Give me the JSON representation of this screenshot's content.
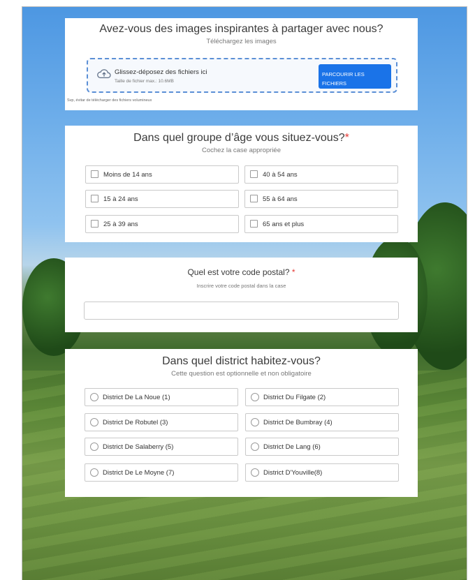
{
  "upload": {
    "title": "Avez-vous des images inspirantes à partager avec nous?",
    "subtitle": "Téléchargez les images",
    "drop_label": "Glissez-déposez des fichiers ici",
    "max_size": "Taille de fichier max.: 10.6MB",
    "browse_label_line1": "PARCOURIR LES",
    "browse_label_line2": "FICHIERS",
    "tip": "Svp, évitar de télécharger des fichiers volumineux"
  },
  "age": {
    "title": "Dans quel groupe d’âge vous situez-vous?",
    "required_mark": "*",
    "subtitle": "Cochez la case appropriée",
    "options": [
      "Moins de 14 ans",
      "40 à 54 ans",
      "15 à 24 ans",
      "55 à 64 ans",
      "25 à 39 ans",
      "65 ans et plus"
    ]
  },
  "postal": {
    "title": "Quel est votre code postal?",
    "required_mark": "*",
    "subtitle": "Inscrire votre code postal dans la case",
    "value": ""
  },
  "district": {
    "title": "Dans quel district habitez-vous?",
    "subtitle": "Cette question est optionnelle et non obligatoire",
    "options": [
      "District De La Noue (1)",
      "District Du Filgate (2)",
      "District De Robutel (3)",
      "District De Bumbray (4)",
      "District De Salaberry (5)",
      "District De Lang (6)",
      "District De Le Moyne (7)",
      "District D'Youville(8)"
    ]
  },
  "colors": {
    "accent": "#1a73e8",
    "required": "#e53935",
    "dropzone_border": "#5b8fd6"
  },
  "icons": {
    "upload": "cloud-upload-icon"
  }
}
